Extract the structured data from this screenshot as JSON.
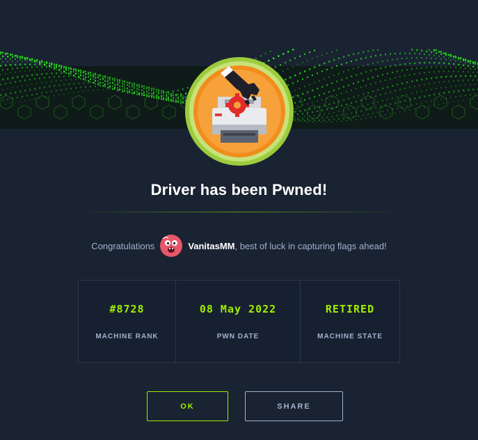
{
  "title": "Driver has been Pwned!",
  "congrats": {
    "lead": "Congratulations",
    "username": "VanitasMM",
    "trail": ", best of luck in capturing flags ahead!"
  },
  "stats": [
    {
      "value": "#8728",
      "label": "MACHINE RANK"
    },
    {
      "value": "08 May 2022",
      "label": "PWN DATE"
    },
    {
      "value": "RETIRED",
      "label": "MACHINE STATE"
    }
  ],
  "buttons": {
    "ok": "OK",
    "share": "SHARE"
  },
  "colors": {
    "background": "#1a2332",
    "accent": "#9fef00",
    "muted": "#a4b1cd",
    "badge_orange": "#f28c1c",
    "badge_ring": "#9ccc3c"
  },
  "icons": {
    "banner": "green-data-wave",
    "badge": "printer-machine-icon",
    "avatar": "user-avatar-face"
  }
}
